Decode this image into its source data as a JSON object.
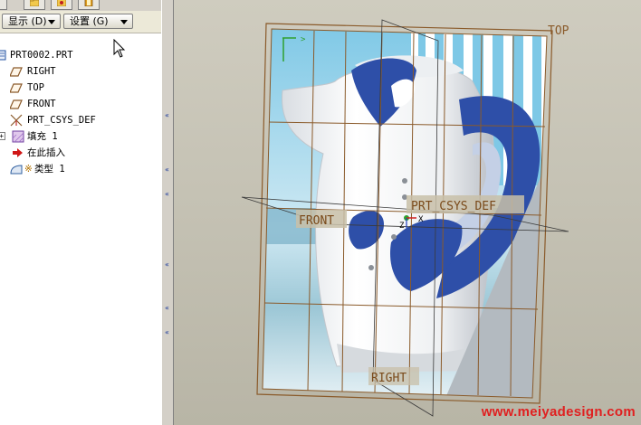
{
  "toolbar": {
    "show_label": "显示 (D)",
    "settings_label": "设置 (G)"
  },
  "tree": {
    "root": "PRT0002.PRT",
    "items": [
      {
        "label": "RIGHT",
        "icon": "datum-plane-icon"
      },
      {
        "label": "TOP",
        "icon": "datum-plane-icon"
      },
      {
        "label": "FRONT",
        "icon": "datum-plane-icon"
      },
      {
        "label": "PRT_CSYS_DEF",
        "icon": "csys-icon"
      },
      {
        "label": "填充 1",
        "icon": "fill-feature-icon"
      },
      {
        "label": "在此插入",
        "icon": "insert-here-arrow-icon"
      },
      {
        "label": "类型 1",
        "icon": "style-feature-icon"
      }
    ]
  },
  "viewport": {
    "labels": {
      "top": "TOP",
      "front": "FRONT",
      "right": "RIGHT",
      "csys": "PRT_CSYS_DEF",
      "csys_x": "X",
      "csys_z": "Z"
    },
    "watermark": "www.meiyadesign.com"
  },
  "colors": {
    "datum": "#8a5a2a",
    "background": "#c8c5b7",
    "kettle_blue": "#2e4fa8",
    "watermark": "#e02020"
  }
}
